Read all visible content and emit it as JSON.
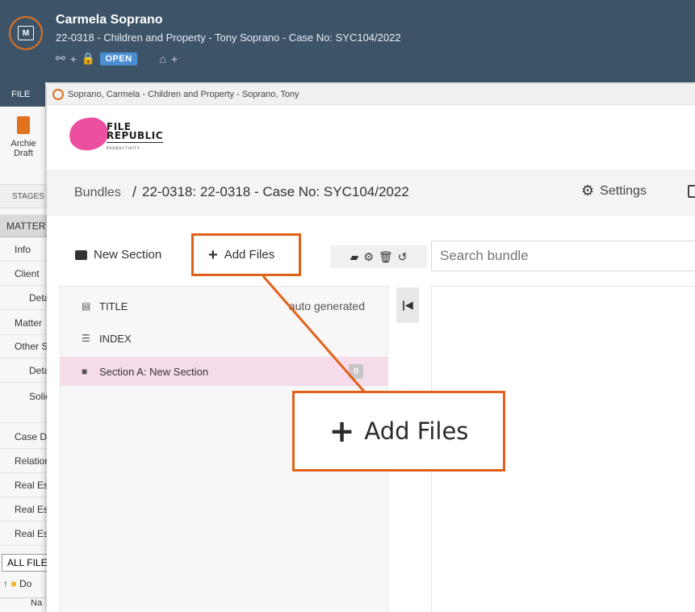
{
  "app": {
    "client_name": "Carmela Soprano",
    "matter_line": "22-0318 - Children and Property - Tony Soprano - Case No: SYC104/2022",
    "status_badge": "OPEN",
    "logo_letter": "M",
    "accent_color": "#e2711d",
    "header_color": "#3d5468"
  },
  "ribbon": {
    "file_tab": "FILE",
    "archie_label": "Archie",
    "draft_label": "Draft",
    "stages_tab": "STAGES",
    "matter_tab": "MATTER"
  },
  "sidebar": {
    "items": [
      "Info",
      "Client",
      "Deta",
      "Matter",
      "Other S",
      "Deta",
      "Solic",
      "Case D",
      "Relation",
      "Real Es",
      "Real Es",
      "Real Es"
    ],
    "all_files": "ALL FILE",
    "tree_item": "Do",
    "column_name": "Na"
  },
  "dialog": {
    "window_title": "Soprano, Carmela - Children and Property - Soprano, Tony",
    "brand_line1": "FILE",
    "brand_line2": "REPUBLIC",
    "brand_tagline": "PRODUCTIVITY",
    "brand_color": "#ec4fa0",
    "breadcrumb_root": "Bundles",
    "breadcrumb_sep": "/",
    "breadcrumb_case": "22-0318: 22-0318 - Case No: SYC104/2022",
    "settings_label": "Settings",
    "new_section_label": "New Section",
    "add_files_label": "Add Files",
    "search_placeholder": "Search bundle",
    "rows": {
      "title_label": "TITLE",
      "title_note": "auto generated",
      "index_label": "INDEX",
      "section_label": "Section A: New Section",
      "section_count": "0"
    }
  },
  "annotation": {
    "callout_label": "Add Files",
    "highlight_color": "#e2611a"
  }
}
